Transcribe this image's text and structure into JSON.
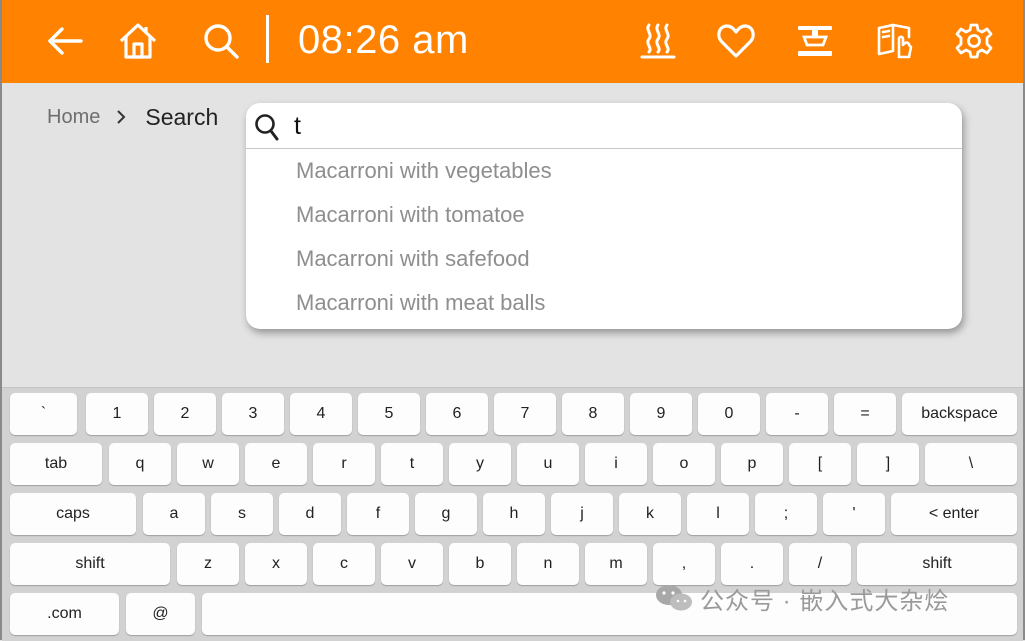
{
  "topbar": {
    "time": "08:26 am",
    "icons": [
      "back-arrow-icon",
      "home-icon",
      "search-icon",
      "steam-heat-icon",
      "heart-icon",
      "scale-icon",
      "manual-book-icon",
      "gear-icon"
    ],
    "background": "#ff8200",
    "foreground": "#ffffff"
  },
  "breadcrumb": {
    "home": "Home",
    "current": "Search"
  },
  "search": {
    "query": "t",
    "suggestions": [
      "Macarroni with vegetables",
      "Macarroni with tomatoe",
      "Macarroni with safefood",
      "Macarroni with meat balls"
    ]
  },
  "keyboard": {
    "rows": [
      [
        "`",
        "1",
        "2",
        "3",
        "4",
        "5",
        "6",
        "7",
        "8",
        "9",
        "0",
        "-",
        "=",
        "backspace"
      ],
      [
        "tab",
        "q",
        "w",
        "e",
        "r",
        "t",
        "y",
        "u",
        "i",
        "o",
        "p",
        "[",
        "]",
        "\\"
      ],
      [
        "caps",
        "a",
        "s",
        "d",
        "f",
        "g",
        "h",
        "j",
        "k",
        "l",
        ";",
        "'",
        "< enter"
      ],
      [
        "shift",
        "z",
        "x",
        "c",
        "v",
        "b",
        "n",
        "m",
        ",",
        ".",
        "/",
        "shift"
      ],
      [
        ".com",
        "@",
        ""
      ]
    ]
  },
  "watermark": {
    "text": "公众号 · 嵌入式大杂烩"
  }
}
